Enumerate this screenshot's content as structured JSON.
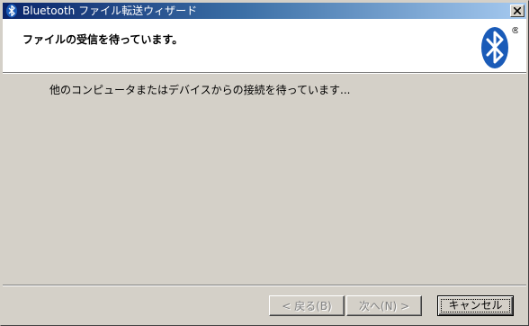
{
  "window": {
    "title": "Bluetooth ファイル転送ウィザード",
    "title_icon": "bluetooth-icon",
    "close_icon": "close-icon"
  },
  "header": {
    "title": "ファイルの受信を待っています。",
    "logo": "bluetooth-logo",
    "logo_mark": "®"
  },
  "body": {
    "status": "他のコンピュータまたはデバイスからの接続を待っています..."
  },
  "buttons": {
    "back": "< 戻る(B)",
    "next": "次へ(N) >",
    "cancel": "キャンセル"
  },
  "colors": {
    "titlebar_start": "#0a246a",
    "titlebar_end": "#a6caf0",
    "dialog_bg": "#d4d0c8",
    "bluetooth_blue": "#1a5bb8"
  }
}
